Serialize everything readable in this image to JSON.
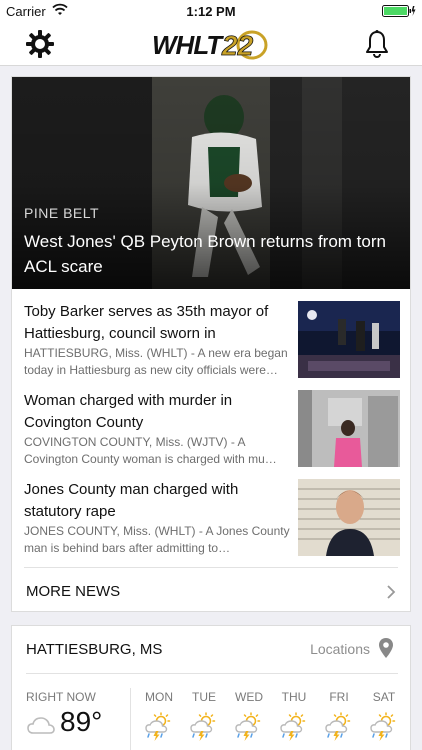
{
  "status_bar": {
    "carrier": "Carrier",
    "time": "1:12 PM"
  },
  "header": {
    "logo_text": "WHLT22",
    "icons": [
      "gear-icon",
      "bell-icon"
    ]
  },
  "hero": {
    "section": "PINE BELT",
    "headline": "West Jones' QB Peyton Brown returns from torn ACL scare"
  },
  "stories": [
    {
      "title": "Toby Barker serves as 35th mayor of Hattiesburg, council sworn in",
      "summary": "HATTIESBURG, Miss. (WHLT) - A new era began today in Hattiesburg as new city officials were…"
    },
    {
      "title": "Woman charged with murder in Covington County",
      "summary": "COVINGTON COUNTY, Miss. (WJTV) - A Covington County woman is charged with mu…"
    },
    {
      "title": "Jones County man charged with statutory rape",
      "summary": "JONES COUNTY, Miss. (WHLT) - A Jones County man is behind bars after admitting to…"
    }
  ],
  "more_news": {
    "label": "MORE NEWS"
  },
  "weather": {
    "location": "HATTIESBURG, MS",
    "locations_label": "Locations",
    "now_label": "RIGHT NOW",
    "now_temp": "89°",
    "now_icon": "cloud-icon",
    "days": [
      {
        "name": "MON",
        "icon": "thunderstorm-icon"
      },
      {
        "name": "TUE",
        "icon": "thunderstorm-icon"
      },
      {
        "name": "WED",
        "icon": "thunderstorm-icon"
      },
      {
        "name": "THU",
        "icon": "thunderstorm-icon"
      },
      {
        "name": "FRI",
        "icon": "thunderstorm-icon"
      },
      {
        "name": "SAT",
        "icon": "thunderstorm-icon"
      }
    ]
  },
  "colors": {
    "accent_gold": "#c9a227",
    "background": "#efeff4",
    "text_muted": "#6e6e6e"
  }
}
